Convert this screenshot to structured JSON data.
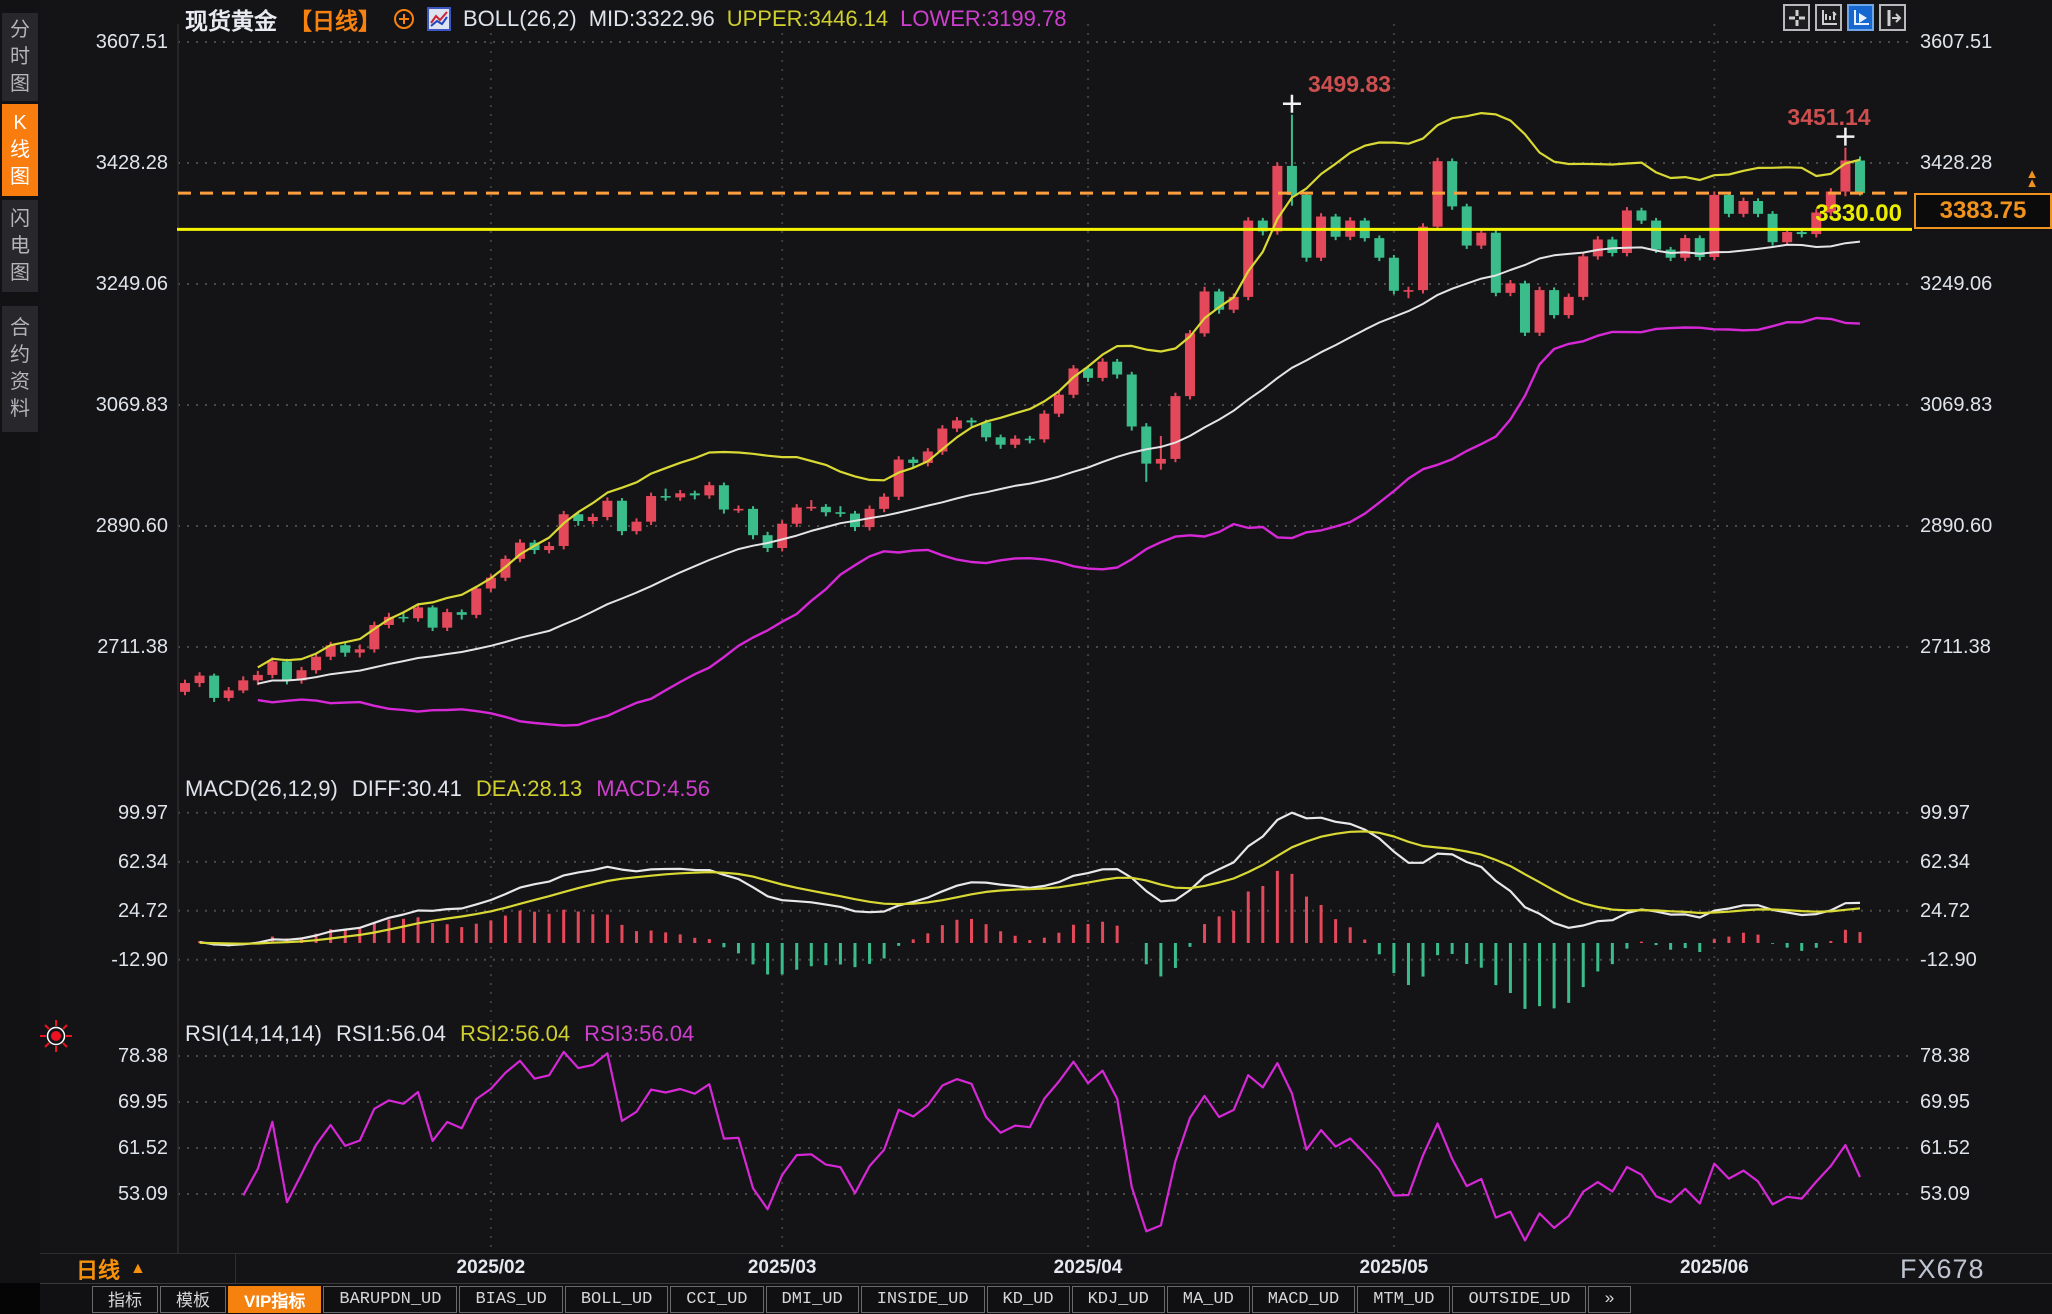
{
  "header": {
    "symbol": "现货黄金",
    "period_tag": "【日线】",
    "boll_label": "BOLL(26,2)",
    "mid": "MID:3322.96",
    "upper": "UPPER:3446.14",
    "lower": "LOWER:3199.78"
  },
  "toolbar": {
    "buttons": [
      {
        "icon": "crosshair-icon",
        "active": false
      },
      {
        "icon": "axis-zoom-icon",
        "active": false
      },
      {
        "icon": "autoplay-icon",
        "active": true
      },
      {
        "icon": "panel-shift-icon",
        "active": false
      }
    ]
  },
  "sidebar": {
    "items": [
      {
        "label": "分时图",
        "active": false
      },
      {
        "label": "K线图",
        "active": true
      },
      {
        "label": "闪电图",
        "active": false
      },
      {
        "label": "合约资料",
        "active": false
      }
    ]
  },
  "macd_header": {
    "params": "MACD(26,12,9)",
    "diff": "DIFF:30.41",
    "dea": "DEA:28.13",
    "macd": "MACD:4.56"
  },
  "rsi_header": {
    "params": "RSI(14,14,14)",
    "rsi1": "RSI1:56.04",
    "rsi2": "RSI2:56.04",
    "rsi3": "RSI3:56.04"
  },
  "axis_bar": {
    "period_label": "日线",
    "arrow": "▲"
  },
  "watermark": "FX678",
  "tabs": [
    {
      "label": "指标",
      "active": false
    },
    {
      "label": "模板",
      "active": false
    },
    {
      "label": "VIP指标",
      "active": true
    },
    {
      "label": "BARUPDN_UD",
      "active": false
    },
    {
      "label": "BIAS_UD",
      "active": false
    },
    {
      "label": "BOLL_UD",
      "active": false
    },
    {
      "label": "CCI_UD",
      "active": false
    },
    {
      "label": "DMI_UD",
      "active": false
    },
    {
      "label": "INSIDE_UD",
      "active": false
    },
    {
      "label": "KD_UD",
      "active": false
    },
    {
      "label": "KDJ_UD",
      "active": false
    },
    {
      "label": "MA_UD",
      "active": false
    },
    {
      "label": "MACD_UD",
      "active": false
    },
    {
      "label": "MTM_UD",
      "active": false
    },
    {
      "label": "OUTSIDE_UD",
      "active": false
    },
    {
      "label": "»",
      "active": false
    }
  ],
  "colors": {
    "up": "#e4495b",
    "down": "#3bbd8b",
    "boll_upper": "#d9d935",
    "boll_mid": "#e4e4e6",
    "boll_lower": "#d628d6",
    "macd_diff": "#e8e8ea",
    "macd_dea": "#d9d935",
    "rsi_line": "#d628d6",
    "hline_yellow": "#f4f400",
    "last_price_line": "#ff9e3c",
    "accent_orange": "#f5820f",
    "annotation_red": "#cd4f4f",
    "grid": "#4a4a4a",
    "axis_text": "#dfe3ea",
    "marker_white": "#f2f2f2"
  },
  "chart_data": {
    "type": "candlestick",
    "title": "现货黄金 日线 (Spot Gold, daily)",
    "ohlc_format": [
      "open",
      "high",
      "low",
      "close"
    ],
    "panes": {
      "price": {
        "ylim": [
          2529,
          3633
        ],
        "ticks": [
          3607.51,
          3428.28,
          3249.06,
          3069.83,
          2890.6,
          2711.38
        ],
        "tick_labels": [
          "3607.51",
          "3428.28",
          "3249.06",
          "3069.83",
          "2890.60",
          "2711.38"
        ]
      },
      "macd": {
        "ylim": [
          -32,
          128
        ],
        "ticks": [
          99.97,
          62.34,
          24.72,
          -12.9
        ],
        "tick_labels": [
          "99.97",
          "62.34",
          "24.72",
          "-12.90"
        ],
        "diff": 30.41,
        "dea": 28.13,
        "macd": 4.56
      },
      "rsi": {
        "ylim": [
          42.5,
          85.5
        ],
        "ticks": [
          78.38,
          69.95,
          61.52,
          53.09
        ],
        "tick_labels": [
          "78.38",
          "69.95",
          "61.52",
          "53.09"
        ],
        "rsi1": 56.04,
        "rsi2": 56.04,
        "rsi3": 56.04
      }
    },
    "boll": {
      "period": 26,
      "mult": 2,
      "mid": 3322.96,
      "upper": 3446.14,
      "lower": 3199.78
    },
    "x_ticks": [
      {
        "label": "2025/02",
        "index": 21
      },
      {
        "label": "2025/03",
        "index": 41
      },
      {
        "label": "2025/04",
        "index": 62
      },
      {
        "label": "2025/05",
        "index": 83
      },
      {
        "label": "2025/06",
        "index": 105
      }
    ],
    "annotations": {
      "high1": {
        "index": 76,
        "price": 3499.83,
        "label": "3499.83"
      },
      "high2": {
        "index": 114,
        "price": 3451.14,
        "label": "3451.14"
      },
      "hline_yellow": {
        "price": 3330.0,
        "label": "3330.00"
      },
      "last_price": {
        "price": 3383.75,
        "label": "3383.75"
      }
    },
    "candles": [
      [
        2645,
        2663,
        2640,
        2658
      ],
      [
        2658,
        2674,
        2652,
        2669
      ],
      [
        2669,
        2672,
        2630,
        2636
      ],
      [
        2636,
        2652,
        2631,
        2647
      ],
      [
        2647,
        2668,
        2643,
        2662
      ],
      [
        2662,
        2676,
        2655,
        2670
      ],
      [
        2670,
        2696,
        2665,
        2690
      ],
      [
        2690,
        2694,
        2656,
        2662
      ],
      [
        2662,
        2682,
        2657,
        2677
      ],
      [
        2677,
        2702,
        2672,
        2697
      ],
      [
        2697,
        2719,
        2692,
        2714
      ],
      [
        2714,
        2718,
        2697,
        2703
      ],
      [
        2703,
        2715,
        2696,
        2708
      ],
      [
        2708,
        2749,
        2703,
        2744
      ],
      [
        2744,
        2762,
        2739,
        2756
      ],
      [
        2756,
        2761,
        2748,
        2754
      ],
      [
        2754,
        2776,
        2749,
        2770
      ],
      [
        2770,
        2773,
        2735,
        2740
      ],
      [
        2740,
        2768,
        2735,
        2763
      ],
      [
        2763,
        2767,
        2752,
        2759
      ],
      [
        2759,
        2802,
        2754,
        2798
      ],
      [
        2798,
        2819,
        2793,
        2814
      ],
      [
        2814,
        2847,
        2809,
        2842
      ],
      [
        2842,
        2871,
        2837,
        2866
      ],
      [
        2866,
        2870,
        2849,
        2855
      ],
      [
        2855,
        2867,
        2850,
        2861
      ],
      [
        2861,
        2913,
        2856,
        2908
      ],
      [
        2908,
        2912,
        2891,
        2898
      ],
      [
        2898,
        2909,
        2893,
        2904
      ],
      [
        2904,
        2933,
        2899,
        2928
      ],
      [
        2928,
        2932,
        2877,
        2883
      ],
      [
        2883,
        2902,
        2878,
        2897
      ],
      [
        2897,
        2940,
        2892,
        2935
      ],
      [
        2935,
        2946,
        2928,
        2933
      ],
      [
        2933,
        2944,
        2928,
        2939
      ],
      [
        2939,
        2943,
        2930,
        2936
      ],
      [
        2936,
        2956,
        2931,
        2951
      ],
      [
        2951,
        2955,
        2909,
        2915
      ],
      [
        2915,
        2921,
        2910,
        2916
      ],
      [
        2916,
        2920,
        2871,
        2877
      ],
      [
        2877,
        2882,
        2852,
        2858
      ],
      [
        2858,
        2899,
        2853,
        2894
      ],
      [
        2894,
        2923,
        2889,
        2918
      ],
      [
        2918,
        2929,
        2913,
        2919
      ],
      [
        2919,
        2923,
        2905,
        2911
      ],
      [
        2911,
        2920,
        2904,
        2909
      ],
      [
        2909,
        2913,
        2883,
        2889
      ],
      [
        2889,
        2921,
        2884,
        2916
      ],
      [
        2916,
        2939,
        2911,
        2934
      ],
      [
        2934,
        2994,
        2929,
        2989
      ],
      [
        2989,
        2993,
        2978,
        2984
      ],
      [
        2984,
        3006,
        2979,
        3001
      ],
      [
        3001,
        3040,
        2996,
        3035
      ],
      [
        3035,
        3052,
        3030,
        3047
      ],
      [
        3047,
        3051,
        3038,
        3044
      ],
      [
        3044,
        3048,
        3016,
        3022
      ],
      [
        3022,
        3026,
        3005,
        3011
      ],
      [
        3011,
        3025,
        3006,
        3020
      ],
      [
        3020,
        3024,
        3013,
        3019
      ],
      [
        3019,
        3062,
        3014,
        3057
      ],
      [
        3057,
        3090,
        3052,
        3085
      ],
      [
        3085,
        3129,
        3080,
        3124
      ],
      [
        3124,
        3128,
        3104,
        3110
      ],
      [
        3110,
        3139,
        3105,
        3134
      ],
      [
        3134,
        3138,
        3109,
        3115
      ],
      [
        3115,
        3119,
        3032,
        3038
      ],
      [
        3038,
        3043,
        2956,
        2983
      ],
      [
        2983,
        3024,
        2974,
        2990
      ],
      [
        2990,
        3088,
        2985,
        3083
      ],
      [
        3083,
        3181,
        3078,
        3176
      ],
      [
        3176,
        3245,
        3171,
        3238
      ],
      [
        3238,
        3242,
        3205,
        3211
      ],
      [
        3211,
        3235,
        3206,
        3230
      ],
      [
        3230,
        3348,
        3225,
        3343
      ],
      [
        3343,
        3347,
        3321,
        3327
      ],
      [
        3327,
        3429,
        3322,
        3424
      ],
      [
        3424,
        3499.83,
        3365,
        3381
      ],
      [
        3381,
        3386,
        3282,
        3288
      ],
      [
        3288,
        3354,
        3283,
        3349
      ],
      [
        3349,
        3353,
        3314,
        3319
      ],
      [
        3319,
        3348,
        3314,
        3343
      ],
      [
        3343,
        3347,
        3312,
        3317
      ],
      [
        3317,
        3321,
        3283,
        3288
      ],
      [
        3288,
        3292,
        3234,
        3239
      ],
      [
        3239,
        3245,
        3228,
        3240
      ],
      [
        3240,
        3339,
        3235,
        3334
      ],
      [
        3334,
        3436,
        3329,
        3431
      ],
      [
        3431,
        3435,
        3359,
        3364
      ],
      [
        3364,
        3368,
        3301,
        3306
      ],
      [
        3306,
        3330,
        3301,
        3325
      ],
      [
        3325,
        3329,
        3231,
        3236
      ],
      [
        3236,
        3255,
        3231,
        3250
      ],
      [
        3250,
        3254,
        3172,
        3177
      ],
      [
        3177,
        3245,
        3172,
        3240
      ],
      [
        3240,
        3244,
        3198,
        3203
      ],
      [
        3203,
        3235,
        3198,
        3230
      ],
      [
        3230,
        3295,
        3225,
        3290
      ],
      [
        3290,
        3320,
        3285,
        3315
      ],
      [
        3315,
        3319,
        3290,
        3295
      ],
      [
        3295,
        3363,
        3290,
        3358
      ],
      [
        3358,
        3362,
        3338,
        3343
      ],
      [
        3343,
        3347,
        3295,
        3300
      ],
      [
        3300,
        3304,
        3283,
        3288
      ],
      [
        3288,
        3322,
        3283,
        3317
      ],
      [
        3317,
        3321,
        3284,
        3289
      ],
      [
        3289,
        3386,
        3284,
        3381
      ],
      [
        3381,
        3385,
        3348,
        3353
      ],
      [
        3353,
        3377,
        3348,
        3372
      ],
      [
        3372,
        3376,
        3348,
        3353
      ],
      [
        3353,
        3357,
        3306,
        3311
      ],
      [
        3311,
        3331,
        3306,
        3326
      ],
      [
        3326,
        3330,
        3318,
        3323
      ],
      [
        3323,
        3360,
        3318,
        3355
      ],
      [
        3355,
        3391,
        3350,
        3386
      ],
      [
        3386,
        3451.14,
        3379,
        3432
      ],
      [
        3432,
        3438,
        3380,
        3383.75
      ]
    ]
  }
}
